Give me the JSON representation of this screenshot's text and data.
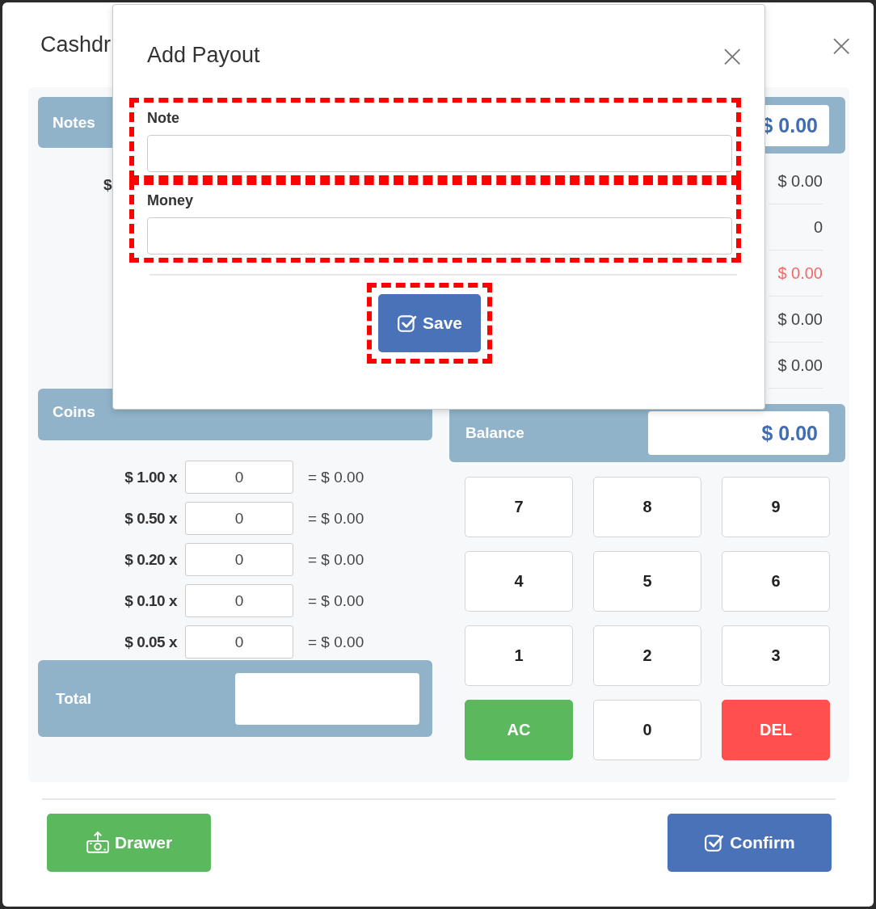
{
  "dialog": {
    "title": "Cashdr",
    "close": "×"
  },
  "notes": {
    "header": "Notes",
    "visible_amount": "$"
  },
  "summary": {
    "header_value": "$ 0.00",
    "rows": [
      {
        "value": "$ 0.00",
        "negative": false
      },
      {
        "value": "0",
        "negative": false
      },
      {
        "value": "$ 0.00",
        "negative": true
      },
      {
        "value": "$ 0.00",
        "negative": false
      },
      {
        "value": "$ 0.00",
        "negative": false
      }
    ]
  },
  "coins": {
    "header": "Coins",
    "rows": [
      {
        "denomination": "$ 1.00 x",
        "count": "0",
        "subtotal": "= $ 0.00"
      },
      {
        "denomination": "$ 0.50 x",
        "count": "0",
        "subtotal": "= $ 0.00"
      },
      {
        "denomination": "$ 0.20 x",
        "count": "0",
        "subtotal": "= $ 0.00"
      },
      {
        "denomination": "$ 0.10 x",
        "count": "0",
        "subtotal": "= $ 0.00"
      },
      {
        "denomination": "$ 0.05 x",
        "count": "0",
        "subtotal": "= $ 0.00"
      }
    ]
  },
  "total": {
    "label": "Total"
  },
  "balance": {
    "label": "Balance",
    "value": "$ 0.00"
  },
  "keypad": [
    {
      "label": "7",
      "kind": "digit"
    },
    {
      "label": "8",
      "kind": "digit"
    },
    {
      "label": "9",
      "kind": "digit"
    },
    {
      "label": "4",
      "kind": "digit"
    },
    {
      "label": "5",
      "kind": "digit"
    },
    {
      "label": "6",
      "kind": "digit"
    },
    {
      "label": "1",
      "kind": "digit"
    },
    {
      "label": "2",
      "kind": "digit"
    },
    {
      "label": "3",
      "kind": "digit"
    },
    {
      "label": "AC",
      "kind": "clear"
    },
    {
      "label": "0",
      "kind": "digit"
    },
    {
      "label": "DEL",
      "kind": "delete"
    }
  ],
  "footer": {
    "buttons": [
      {
        "label": "Drawer",
        "kind": "drawer"
      },
      {
        "label": "Confirm",
        "kind": "confirm"
      }
    ]
  },
  "payout_dialog": {
    "title": "Add Payout",
    "close": "×",
    "fields": [
      {
        "label": "Note",
        "highlighted": true
      },
      {
        "label": "Money",
        "highlighted": true
      }
    ],
    "save": {
      "label": "Save",
      "highlighted": true
    }
  }
}
